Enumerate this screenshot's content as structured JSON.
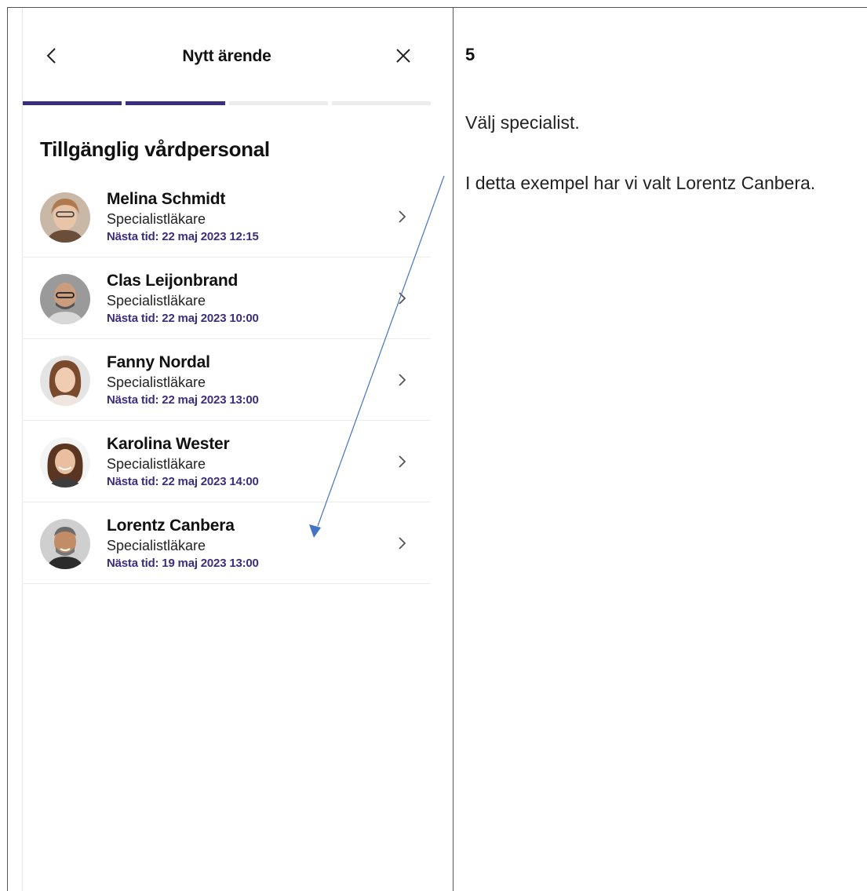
{
  "phone": {
    "header": {
      "title": "Nytt ärende",
      "back_icon": "chevron-left-icon",
      "close_icon": "close-icon"
    },
    "progress": {
      "steps_total": 4,
      "steps_done": 2,
      "accent": "#3b2f7d"
    },
    "section_title": "Tillgänglig vårdpersonal",
    "staff": [
      {
        "name": "Melina Schmidt",
        "role": "Specialistläkare",
        "next": "Nästa tid: 22 maj 2023 12:15"
      },
      {
        "name": "Clas Leijonbrand",
        "role": "Specialistläkare",
        "next": "Nästa tid: 22 maj 2023 10:00"
      },
      {
        "name": "Fanny Nordal",
        "role": "Specialistläkare",
        "next": "Nästa tid: 22 maj 2023 13:00"
      },
      {
        "name": "Karolina Wester",
        "role": "Specialistläkare",
        "next": "Nästa tid: 22 maj 2023 14:00"
      },
      {
        "name": "Lorentz Canbera",
        "role": "Specialistläkare",
        "next": "Nästa tid: 19 maj 2023 13:00"
      }
    ]
  },
  "instructions": {
    "step": "5",
    "line1": "Välj specialist.",
    "line2": "I detta exempel har vi valt Lorentz Canbera."
  },
  "colors": {
    "annotation_arrow": "#4472c4",
    "secondary_text": "#3b2f7d"
  }
}
